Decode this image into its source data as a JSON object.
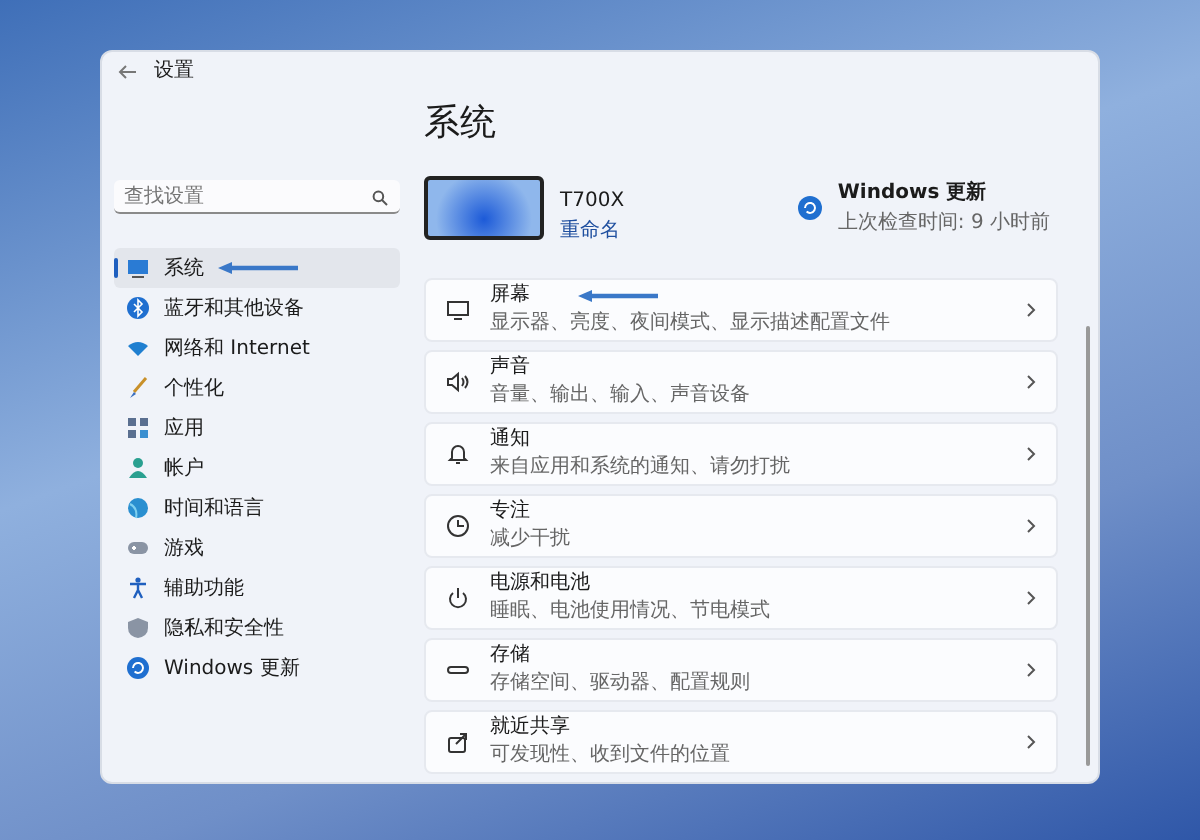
{
  "window": {
    "title": "设置"
  },
  "search": {
    "placeholder": "查找设置"
  },
  "sidebar": {
    "items": [
      {
        "label": "系统",
        "kind": "system",
        "selected": true,
        "arrow": true
      },
      {
        "label": "蓝牙和其他设备",
        "kind": "bluetooth",
        "selected": false,
        "arrow": false
      },
      {
        "label": "网络和 Internet",
        "kind": "network",
        "selected": false,
        "arrow": false
      },
      {
        "label": "个性化",
        "kind": "brush",
        "selected": false,
        "arrow": false
      },
      {
        "label": "应用",
        "kind": "apps",
        "selected": false,
        "arrow": false
      },
      {
        "label": "帐户",
        "kind": "account",
        "selected": false,
        "arrow": false
      },
      {
        "label": "时间和语言",
        "kind": "globe",
        "selected": false,
        "arrow": false
      },
      {
        "label": "游戏",
        "kind": "gamepad",
        "selected": false,
        "arrow": false
      },
      {
        "label": "辅助功能",
        "kind": "person",
        "selected": false,
        "arrow": false
      },
      {
        "label": "隐私和安全性",
        "kind": "shield",
        "selected": false,
        "arrow": false
      },
      {
        "label": "Windows 更新",
        "kind": "update",
        "selected": false,
        "arrow": false
      }
    ]
  },
  "page": {
    "title": "系统"
  },
  "device": {
    "name": "T700X",
    "rename": "重命名"
  },
  "update": {
    "title": "Windows 更新",
    "subtitle": "上次检查时间: 9 小时前"
  },
  "settings": [
    {
      "title": "屏幕",
      "description": "显示器、亮度、夜间模式、显示描述配置文件",
      "kind": "monitor",
      "arrow": true
    },
    {
      "title": "声音",
      "description": "音量、输出、输入、声音设备",
      "kind": "speaker",
      "arrow": false
    },
    {
      "title": "通知",
      "description": "来自应用和系统的通知、请勿打扰",
      "kind": "bell",
      "arrow": false
    },
    {
      "title": "专注",
      "description": "减少干扰",
      "kind": "focus",
      "arrow": false
    },
    {
      "title": "电源和电池",
      "description": "睡眠、电池使用情况、节电模式",
      "kind": "power",
      "arrow": false
    },
    {
      "title": "存储",
      "description": "存储空间、驱动器、配置规则",
      "kind": "storage",
      "arrow": false
    },
    {
      "title": "就近共享",
      "description": "可发现性、收到文件的位置",
      "kind": "share",
      "arrow": false
    }
  ]
}
